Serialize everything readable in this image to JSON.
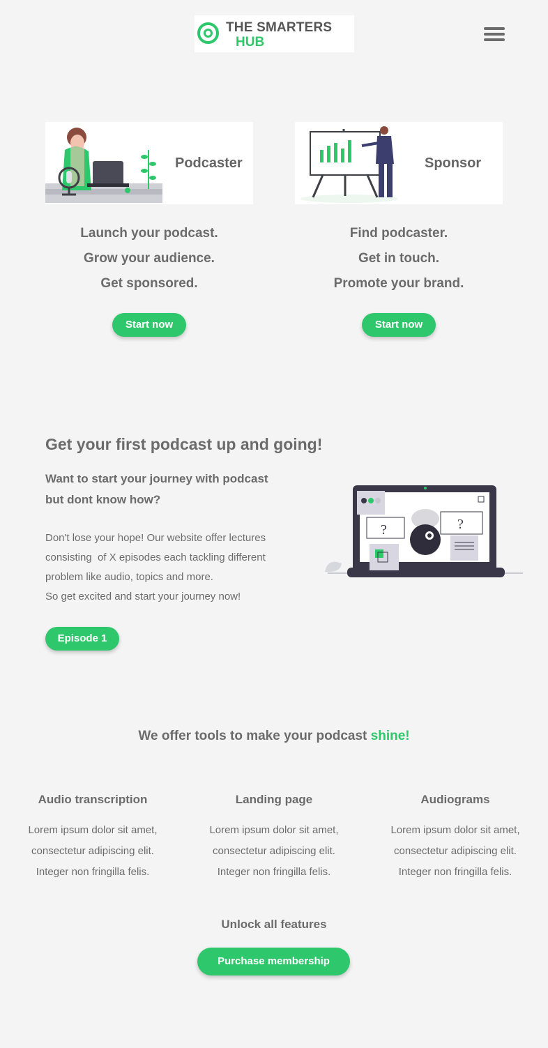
{
  "brand": {
    "line1": "THE SMARTERS",
    "line2": "HUB",
    "accent_color": "#2ec76b"
  },
  "header": {
    "menu_icon": "hamburger-menu-icon"
  },
  "roles": [
    {
      "title": "Podcaster",
      "lines": [
        "Launch your podcast.",
        "Grow your audience.",
        "Get sponsored."
      ],
      "button": "Start now"
    },
    {
      "title": "Sponsor",
      "lines": [
        "Find podcaster.",
        "Get in touch.",
        "Promote your brand."
      ],
      "button": "Start now"
    }
  ],
  "intro": {
    "heading": "Get your first podcast up and going!",
    "subheading_line1": "Want to start your journey with podcast",
    "subheading_line2": "but dont know how?",
    "para": [
      "Don't lose your hope! Our website offer lectures",
      "consisting  of X episodes each tackling different",
      "problem like audio, topics and more.",
      "So get excited and start your journey now!"
    ],
    "button": "Episode 1"
  },
  "tools": {
    "heading": "We offer tools to make your podcast ",
    "heading_accent": "shine!",
    "features": [
      {
        "title": "Audio transcription",
        "desc": [
          "Lorem ipsum dolor sit amet,",
          "consectetur adipiscing elit.",
          "Integer non fringilla felis."
        ]
      },
      {
        "title": "Landing page",
        "desc": [
          "Lorem ipsum dolor sit amet,",
          "consectetur adipiscing elit.",
          "Integer non fringilla felis."
        ]
      },
      {
        "title": "Audiograms",
        "desc": [
          "Lorem ipsum dolor sit amet,",
          "consectetur adipiscing elit.",
          "Integer non fringilla felis."
        ]
      }
    ],
    "unlock": "Unlock all features",
    "button": "Purchase membership"
  }
}
